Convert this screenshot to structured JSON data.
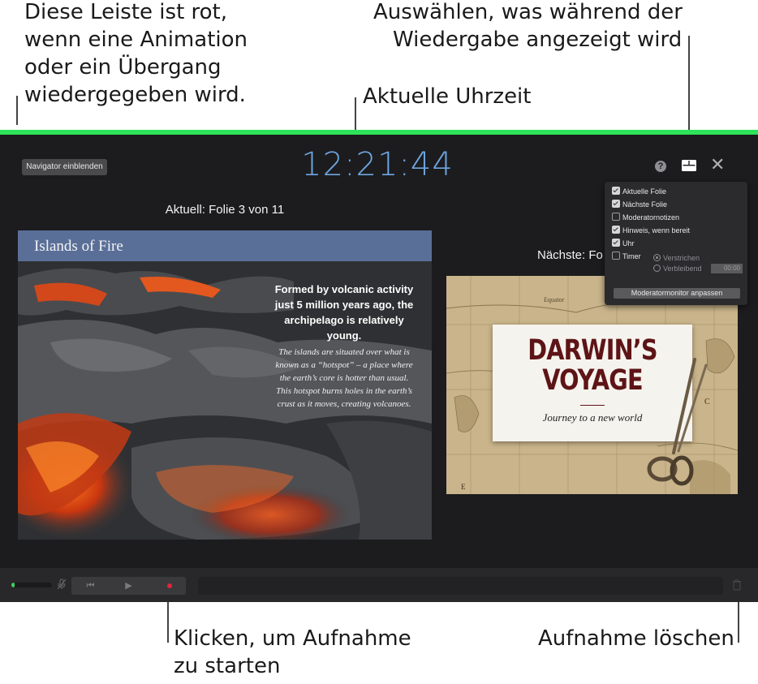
{
  "callouts": {
    "top_left": "Diese Leiste ist rot,\nwenn eine Animation\noder ein Übergang\nwiedergegeben wird.",
    "top_right_line1": "Auswählen, was während der",
    "top_right_line2": "Wiedergabe angezeigt wird",
    "clock": "Aktuelle Uhrzeit",
    "record": "Klicken, um Aufnahme\nzu starten",
    "delete": "Aufnahme löschen"
  },
  "colors": {
    "progress_bar": "#2ee35a",
    "clock": "#6fa6e2",
    "record": "#e0263a",
    "slide_header": "#5a6f98",
    "darwin_title": "#5e1416"
  },
  "toolbar": {
    "navigator_button": "Navigator einblenden",
    "clock_time": "12:21:44",
    "help_icon": "?",
    "layout_icon": "layout-icon",
    "close_icon": "✕"
  },
  "current": {
    "label": "Aktuell: Folie 3 von 11",
    "slide_title": "Islands of Fire",
    "bold_text": "Formed by volcanic activity just 5 million years ago, the archipelago is relatively young.",
    "italic_text": "The islands are situated over what is known as a “hotspot” – a place where the earth’s core is hotter than usual. This hotspot burns holes in the earth’s crust as it moves, creating volcanoes."
  },
  "next": {
    "label": "Nächste: Fo",
    "title": "DARWIN’S\nVOYAGE",
    "subtitle": "Journey to a new world",
    "map_labels": [
      "Equator",
      "E",
      "C"
    ]
  },
  "popover": {
    "options": [
      {
        "label": "Aktuelle Folie",
        "checked": true
      },
      {
        "label": "Nächste Folie",
        "checked": true
      },
      {
        "label": "Moderatornotizen",
        "checked": false
      },
      {
        "label": "Hinweis, wenn bereit",
        "checked": true
      },
      {
        "label": "Uhr",
        "checked": true
      },
      {
        "label": "Timer",
        "checked": false
      }
    ],
    "timer_modes": [
      {
        "label": "Verstrichen",
        "selected": true
      },
      {
        "label": "Verbleibend",
        "selected": false
      }
    ],
    "timer_value": "00:00",
    "customize_button": "Moderatormonitor anpassen"
  },
  "recording": {
    "level": 0.08,
    "prev_glyph": "⏮",
    "play_glyph": "▶"
  }
}
